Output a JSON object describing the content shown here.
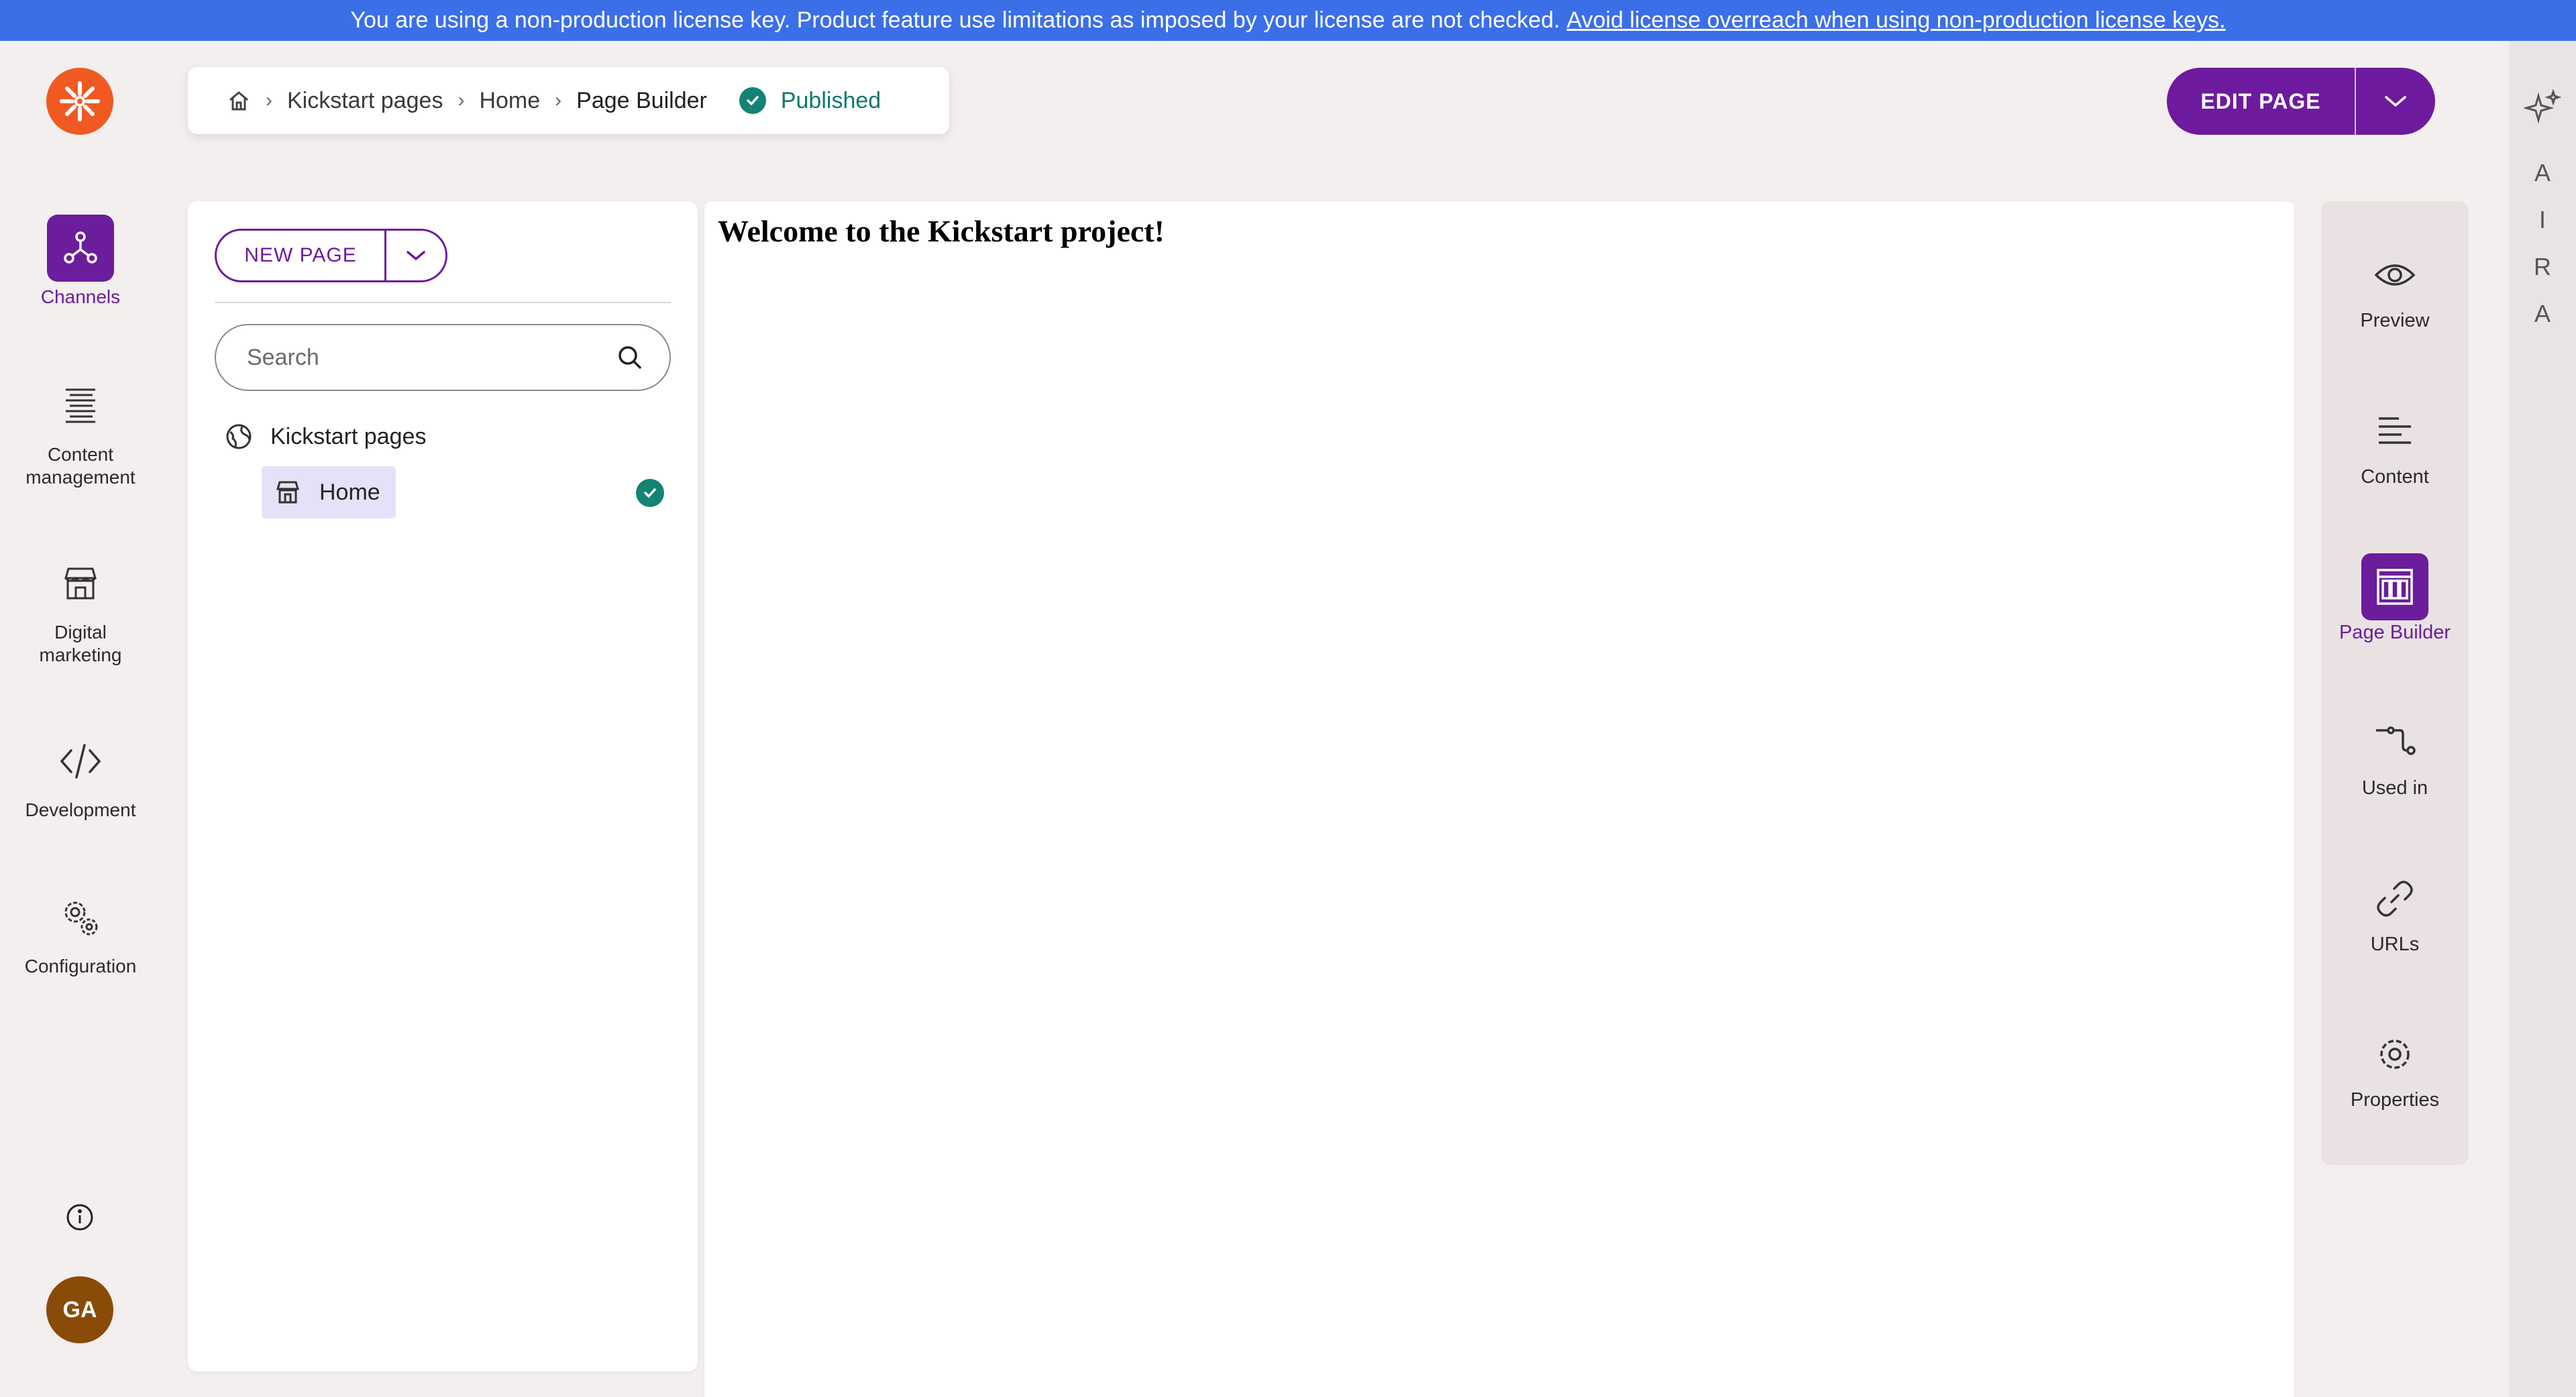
{
  "license_banner": {
    "text": "You are using a non-production license key. Product feature use limitations as imposed by your license are not checked.",
    "link": "Avoid license overreach when using non-production license keys."
  },
  "left_nav": {
    "items": [
      {
        "label": "Channels",
        "icon": "channels-icon",
        "active": true
      },
      {
        "label": "Content management",
        "icon": "content-management-icon"
      },
      {
        "label": "Digital marketing",
        "icon": "storefront-icon"
      },
      {
        "label": "Development",
        "icon": "code-icon"
      },
      {
        "label": "Configuration",
        "icon": "gears-icon"
      }
    ],
    "avatar_initials": "GA"
  },
  "breadcrumb": {
    "items": [
      "Kickstart pages",
      "Home",
      "Page Builder"
    ],
    "status": "Published"
  },
  "edit_button": {
    "label": "EDIT PAGE"
  },
  "tree_panel": {
    "new_page_label": "NEW PAGE",
    "search_placeholder": "Search",
    "root_label": "Kickstart pages",
    "child_label": "Home"
  },
  "canvas": {
    "heading": "Welcome to the Kickstart project!"
  },
  "tools": {
    "items": [
      {
        "label": "Preview",
        "icon": "eye-icon"
      },
      {
        "label": "Content",
        "icon": "content-lines-icon"
      },
      {
        "label": "Page Builder",
        "icon": "page-builder-icon",
        "active": true
      },
      {
        "label": "Used in",
        "icon": "used-in-icon"
      },
      {
        "label": "URLs",
        "icon": "link-icon"
      },
      {
        "label": "Properties",
        "icon": "gear-icon"
      }
    ]
  },
  "aira": {
    "letters": [
      "A",
      "I",
      "R",
      "A"
    ]
  },
  "colors": {
    "accent": "#6e1a9e",
    "banner": "#3b6fe8",
    "success": "#138374",
    "logo": "#f05a22"
  }
}
